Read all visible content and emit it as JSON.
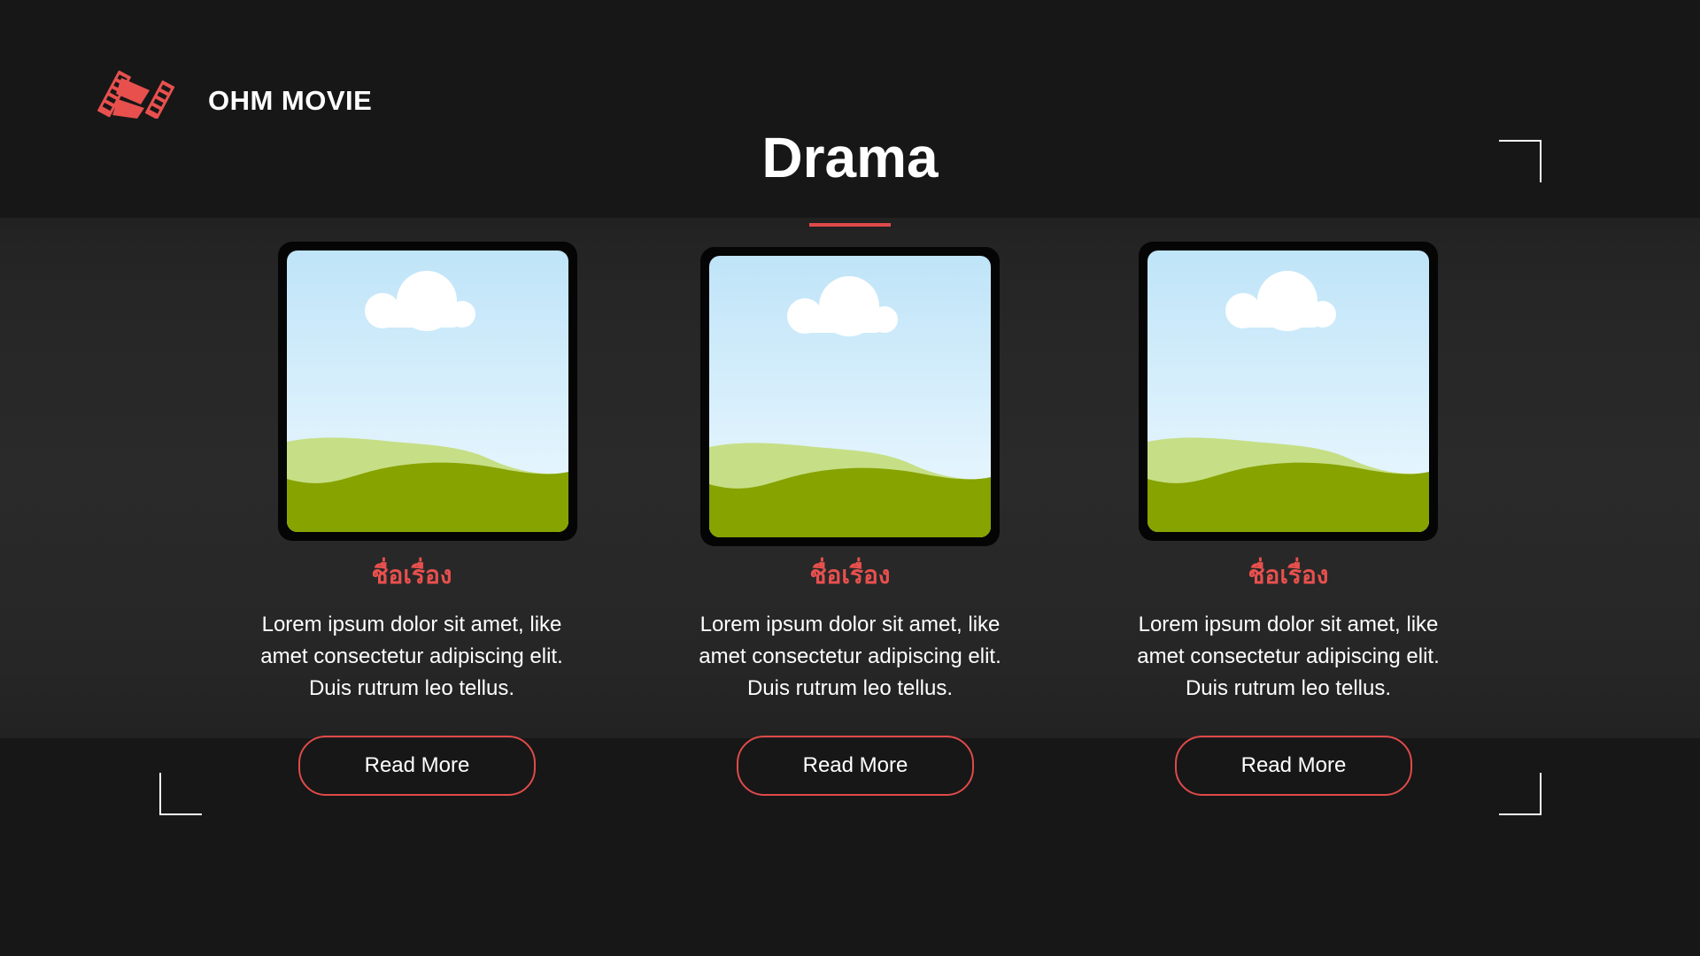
{
  "brand": {
    "name": "OHM MOVIE",
    "logo_icon": "film-reel-icon",
    "accent_color": "#e8504e"
  },
  "page": {
    "title": "Drama",
    "background": "#171717"
  },
  "cards": [
    {
      "image_icon": "landscape-placeholder-icon",
      "title": "ชื่อเรื่อง",
      "description": "Lorem ipsum dolor sit amet, like\namet consectetur adipiscing elit.\nDuis rutrum leo tellus.",
      "button_label": "Read More"
    },
    {
      "image_icon": "landscape-placeholder-icon",
      "title": "ชื่อเรื่อง",
      "description": "Lorem ipsum dolor sit amet, like\namet consectetur adipiscing elit.\nDuis rutrum leo tellus.",
      "button_label": "Read More"
    },
    {
      "image_icon": "landscape-placeholder-icon",
      "title": "ชื่อเรื่อง",
      "description": "Lorem ipsum dolor sit amet, like\namet consectetur adipiscing elit.\nDuis rutrum leo tellus.",
      "button_label": "Read More"
    }
  ]
}
